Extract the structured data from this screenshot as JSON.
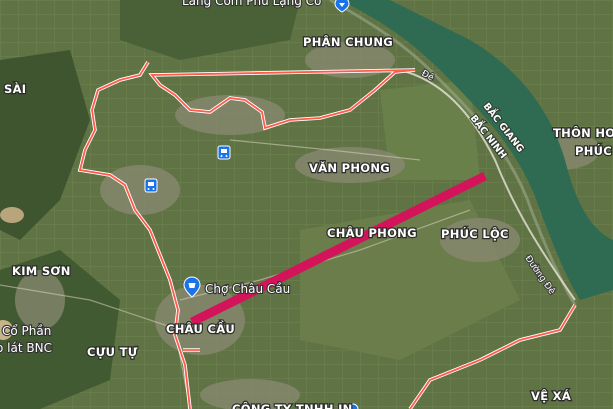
{
  "map": {
    "top_label": "Lăng Cơm Phủ Lạng Cơ",
    "places": {
      "phan_chung": "PHÂN CHUNG",
      "van_phong": "VĂN PHONG",
      "chau_phong": "CHÂU PHONG",
      "phuc_loc": "PHÚC LỘC",
      "kim_son": "KIM SƠN",
      "chau_cau": "CHÂU CẦU",
      "cuu_tu": "CỰU TỰ",
      "ve_xa": "VỆ XÁ",
      "sai": "SÀI",
      "thon_hoa": "THÔN HOA",
      "phuc": "PHÚC",
      "co_phan": "Cổ Phần",
      "lat_bnc": "o lát BNC",
      "cong_ty": "CÔNG TY TNHH IN"
    },
    "poi": {
      "market": "Chợ Châu Cầu"
    },
    "roads": {
      "de_top": "Đê",
      "duong_de": "Đường Đê"
    },
    "provinces": {
      "bac_giang": "BẮC GIANG",
      "bac_ninh": "BẮC NINH"
    },
    "colors": {
      "boundary": "#ff5a4a",
      "highlight_line": "#d4145a",
      "river": "#2f6b52"
    },
    "icons": [
      "bus-stop-icon",
      "bus-stop-icon",
      "market-pin-icon",
      "location-pin-icon"
    ]
  }
}
